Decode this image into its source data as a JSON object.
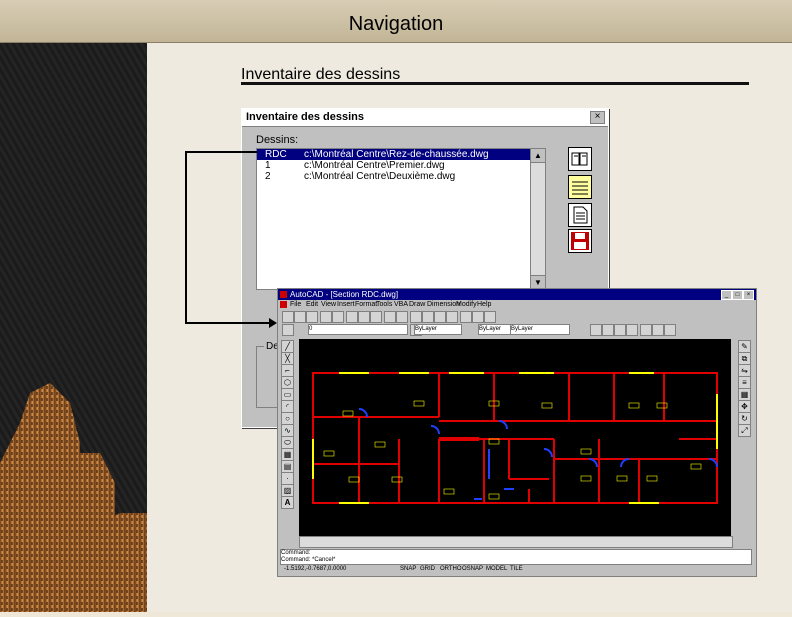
{
  "header": {
    "title": "Navigation"
  },
  "slide": {
    "heading": "Inventaire des dessins"
  },
  "dialog": {
    "title": "Inventaire des dessins",
    "close_glyph": "×",
    "list_label": "Dessins:",
    "rows": [
      {
        "num": "RDC",
        "path": "c:\\Montréal Centre\\Rez-de-chaussée.dwg",
        "selected": true
      },
      {
        "num": "1",
        "path": "c:\\Montréal Centre\\Premier.dwg",
        "selected": false
      },
      {
        "num": "2",
        "path": "c:\\Montréal Centre\\Deuxième.dwg",
        "selected": false
      }
    ],
    "group_label": "De",
    "side_icons": [
      "book-icon",
      "list-icon",
      "document-icon",
      "save-icon"
    ]
  },
  "acad": {
    "title": "AutoCAD - [Section RDC.dwg]",
    "menu": [
      "File",
      "Edit",
      "View",
      "Insert",
      "Format",
      "Tools",
      "VBA",
      "Draw",
      "Dimension",
      "Modify",
      "Help"
    ],
    "layer_combo": "0",
    "linetype_combo": "ByLayer",
    "color_combo": "ByLayer",
    "lineweight_combo": "ByLayer",
    "command_line_1": "Command:",
    "command_line_2": "Command: *Cancel*",
    "status_coords": "-1.5192,-0.7687,0.0000",
    "status_modes": [
      "SNAP",
      "GRID",
      "ORTHO",
      "OSNAP",
      "MODEL",
      "TILE"
    ]
  },
  "colors": {
    "walls": "#e00000",
    "doors": "#2040ff",
    "windows": "#ffff00",
    "selection": "#000080",
    "drawing_bg": "#000000"
  }
}
